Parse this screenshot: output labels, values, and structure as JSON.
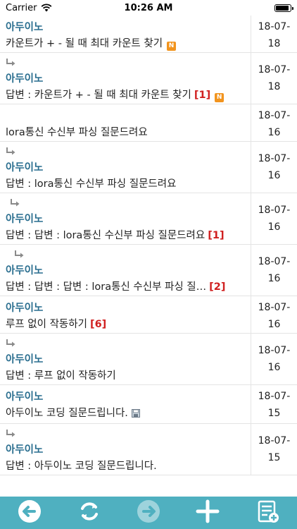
{
  "status_bar": {
    "carrier": "Carrier",
    "time": "10:26 AM",
    "battery_level": 0.9
  },
  "posts": [
    {
      "indent": 0,
      "author": "아두이노",
      "title": "카운트가 + - 될 때 최대 카운트 찾기",
      "count": "",
      "new": true,
      "file": false,
      "date_line1": "18-07-",
      "date_line2": "18"
    },
    {
      "indent": 1,
      "author": "아두이노",
      "title": "답변 : 카운트가 + - 될 때 최대 카운트 찾기",
      "count": "[1]",
      "new": true,
      "file": false,
      "date_line1": "18-07-",
      "date_line2": "18"
    },
    {
      "indent": 0,
      "author": "",
      "title": "lora통신 수신부 파싱 질문드려요",
      "count": "",
      "new": false,
      "file": false,
      "date_line1": "18-07-",
      "date_line2": "16"
    },
    {
      "indent": 1,
      "author": "아두이노",
      "title": "답변 : lora통신 수신부 파싱 질문드려요",
      "count": "",
      "new": false,
      "file": false,
      "date_line1": "18-07-",
      "date_line2": "16"
    },
    {
      "indent": 2,
      "author": "아두이노",
      "title": "답변 : 답변 : lora통신 수신부 파싱 질문드려요",
      "count": "[1]",
      "new": false,
      "file": false,
      "date_line1": "18-07-",
      "date_line2": "16"
    },
    {
      "indent": 3,
      "author": "아두이노",
      "title": "답변 : 답변 : 답변 : lora통신 수신부 파싱 질…",
      "count": "[2]",
      "new": false,
      "file": false,
      "date_line1": "18-07-",
      "date_line2": "16"
    },
    {
      "indent": 0,
      "author": "아두이노",
      "title": "루프 없이 작동하기",
      "count": "[6]",
      "new": false,
      "file": false,
      "date_line1": "18-07-",
      "date_line2": "16"
    },
    {
      "indent": 1,
      "author": "아두이노",
      "title": "답변 : 루프 없이 작동하기",
      "count": "",
      "new": false,
      "file": false,
      "date_line1": "18-07-",
      "date_line2": "16"
    },
    {
      "indent": 0,
      "author": "아두이노",
      "title": "아두이노 코딩 질문드립니다.",
      "count": "",
      "new": false,
      "file": true,
      "date_line1": "18-07-",
      "date_line2": "15"
    },
    {
      "indent": 1,
      "author": "아두이노",
      "title": "답변 : 아두이노 코딩 질문드립니다.",
      "count": "",
      "new": false,
      "file": false,
      "date_line1": "18-07-",
      "date_line2": "15"
    }
  ],
  "badges": {
    "new_label": "N"
  },
  "toolbar": {
    "buttons": [
      {
        "name": "back-button",
        "icon": "arrow-left-icon",
        "enabled": true
      },
      {
        "name": "refresh-button",
        "icon": "refresh-icon",
        "enabled": true
      },
      {
        "name": "forward-button",
        "icon": "arrow-right-icon",
        "enabled": false
      },
      {
        "name": "add-post-button",
        "icon": "plus-icon",
        "enabled": true
      },
      {
        "name": "compose-list-button",
        "icon": "list-add-icon",
        "enabled": true
      }
    ]
  },
  "colors": {
    "accent": "#4fb0c0",
    "author": "#2a6e8f",
    "count": "#d02020",
    "new_badge": "#f2941e"
  }
}
